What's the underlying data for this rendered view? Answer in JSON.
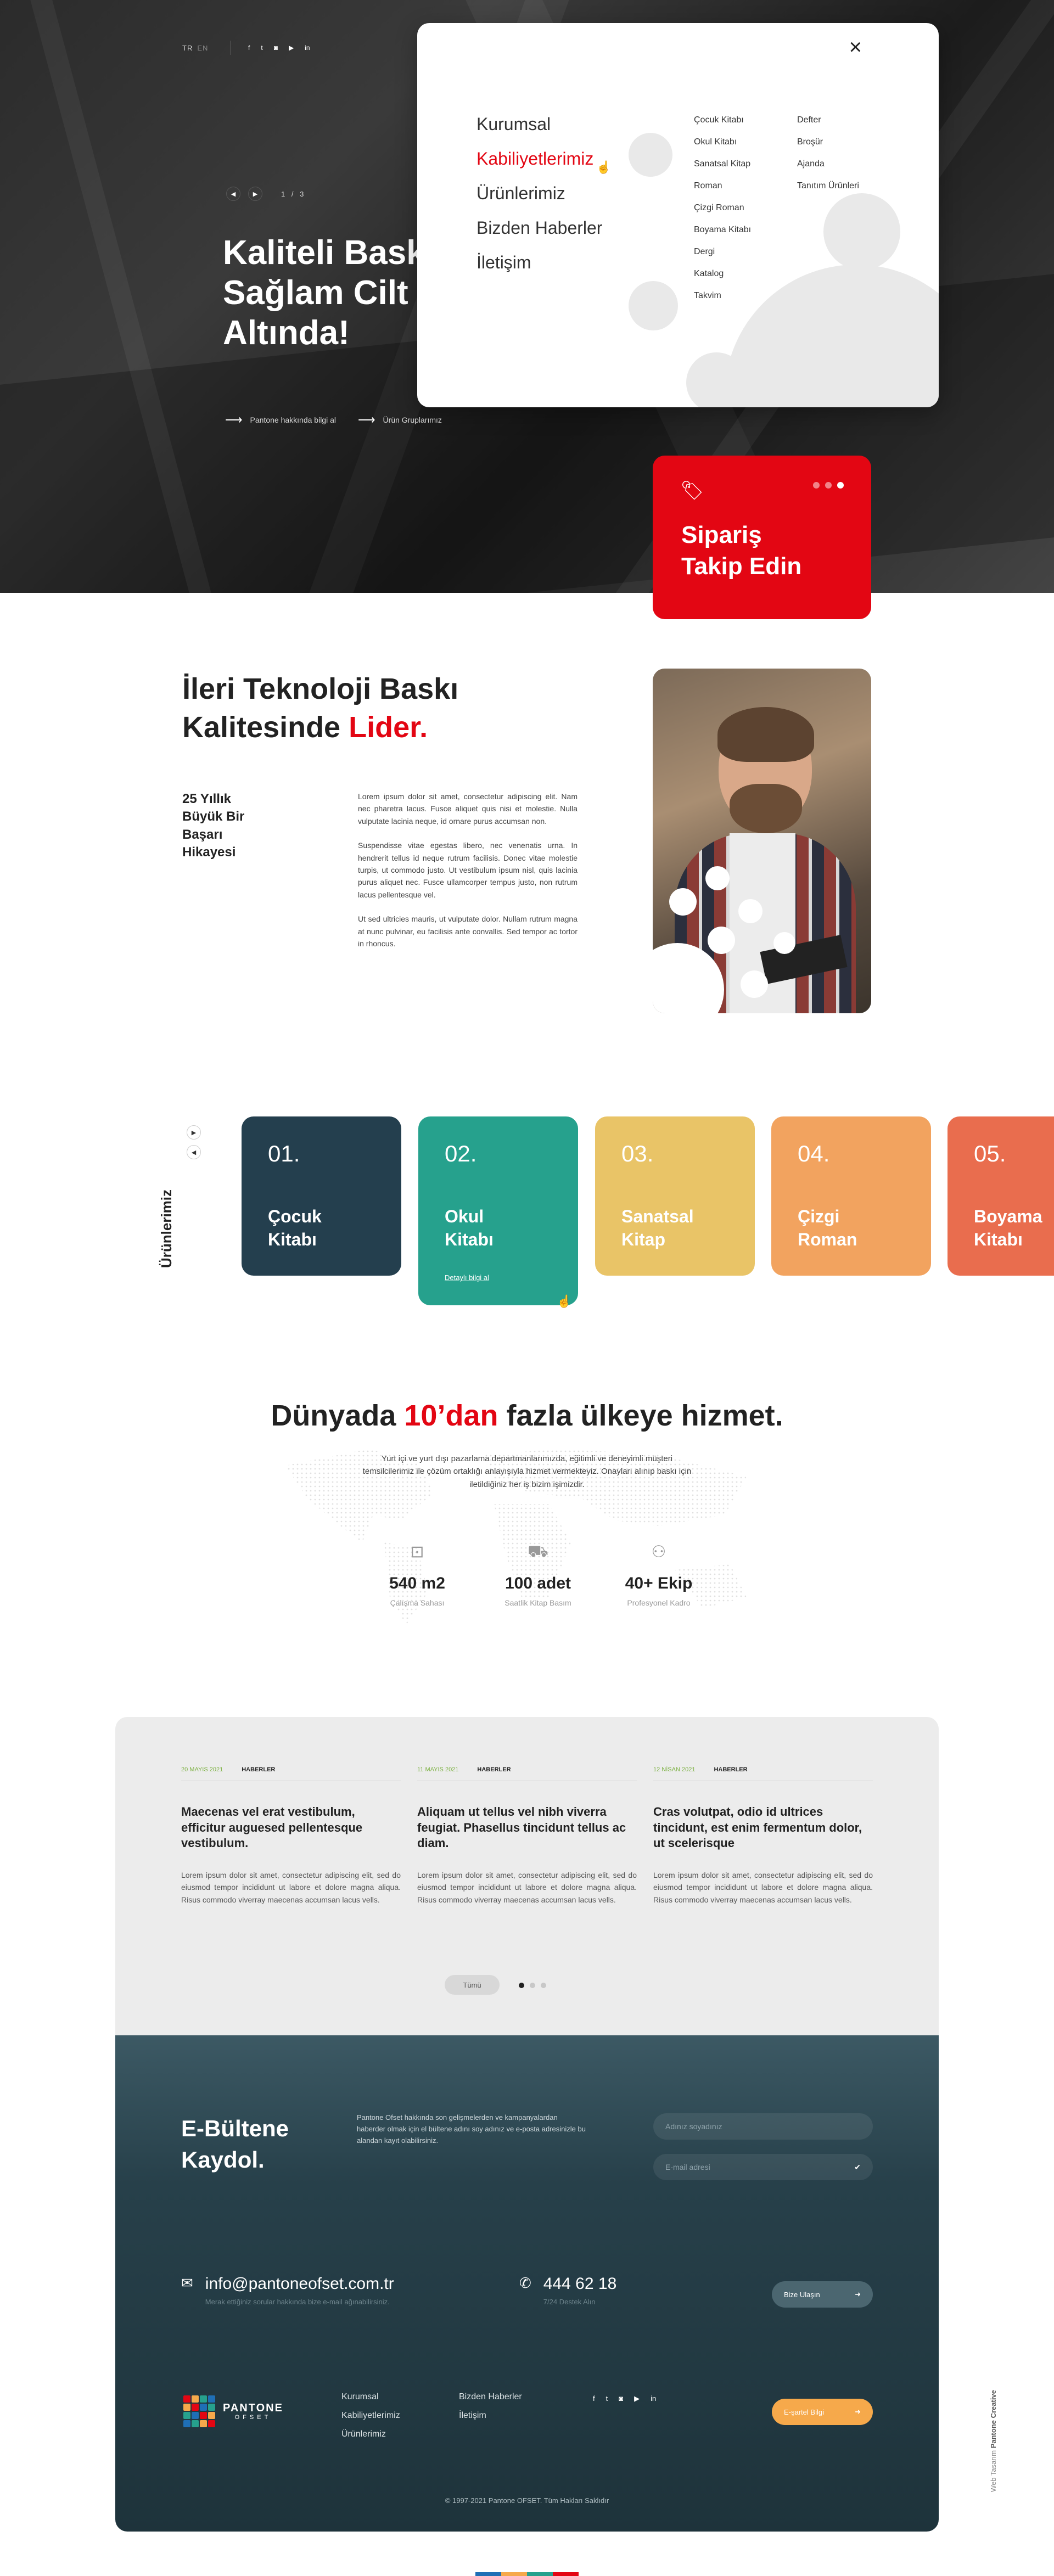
{
  "hero": {
    "lang": {
      "tr": "TR",
      "en": "EN"
    },
    "social": [
      "f",
      "t",
      "◙",
      "▶",
      "in"
    ],
    "slide_counter": "1 / 3",
    "title": "Kaliteli Baskı Sağlam Cilt Altında!",
    "links": [
      {
        "label": "Pantone hakkında bilgi al"
      },
      {
        "label": "Ürün Gruplarımız"
      }
    ]
  },
  "menu": {
    "main": [
      "Kurumsal",
      "Kabiliyetlerimiz",
      "Ürünlerimiz",
      "Bizden Haberler",
      "İletişim"
    ],
    "active_index": 1,
    "col1": [
      "Çocuk Kitabı",
      "Okul Kitabı",
      "Sanatsal Kitap",
      "Roman",
      "Çizgi Roman",
      "Boyama Kitabı",
      "Dergi",
      "Katalog",
      "Takvim"
    ],
    "col2": [
      "Defter",
      "Broşür",
      "Ajanda",
      "Tanıtım Ürünleri"
    ]
  },
  "order": {
    "title": "Sipariş Takip Edin"
  },
  "about": {
    "title_1": "İleri Teknoloji Baskı Kalitesinde ",
    "title_red": "Lider.",
    "side": "25 Yıllık Büyük Bir Başarı Hikayesi",
    "p1": "Lorem ipsum dolor sit amet, consectetur adipiscing elit. Nam nec pharetra lacus. Fusce aliquet quis nisi et molestie. Nulla vulputate lacinia neque, id ornare purus accumsan non.",
    "p2": "Suspendisse vitae egestas libero, nec venenatis urna. In hendrerit tellus id neque rutrum facilisis. Donec vitae molestie turpis, ut commodo justo. Ut vestibulum ipsum nisl, quis lacinia purus aliquet nec. Fusce ullamcorper tempus justo, non rutrum lacus pellentesque vel.",
    "p3": "Ut sed ultricies mauris, ut vulputate dolor. Nullam rutrum magna at nunc pulvinar, eu facilisis ante convallis. Sed tempor ac tortor in rhoncus."
  },
  "products": {
    "label": "Ürünlerimiz",
    "cards": [
      {
        "num": "01.",
        "name": "Çocuk Kitabı",
        "color": "#243f4e"
      },
      {
        "num": "02.",
        "name": "Okul Kitabı",
        "color": "#26a18d",
        "more": "Detaylı bilgi al"
      },
      {
        "num": "03.",
        "name": "Sanatsal Kitap",
        "color": "#e9c467"
      },
      {
        "num": "04.",
        "name": "Çizgi Roman",
        "color": "#f2a35f"
      },
      {
        "num": "05.",
        "name": "Boyama Kitabı",
        "color": "#e96d4e"
      }
    ]
  },
  "world": {
    "title_1": "Dünyada ",
    "title_red": "10’dan",
    "title_2": " fazla ülkeye hizmet.",
    "desc": "Yurt içi ve yurt dışı pazarlama departmanlarımızda, eğitimli ve deneyimli müşteri temsilcilerimiz ile çözüm ortaklığı anlayışıyla hizmet vermekteyiz. Onayları alınıp baskı için iletildiğiniz her iş bizim işimizdir.",
    "stats": [
      {
        "icon": "⊡",
        "value": "540 m2",
        "label": "Çalışma Sahası"
      },
      {
        "icon": "⛟",
        "value": "100 adet",
        "label": "Saatlik Kitap Basım"
      },
      {
        "icon": "⚇",
        "value": "40+ Ekip",
        "label": "Profesyonel Kadro"
      }
    ]
  },
  "news": {
    "items": [
      {
        "date": "20 MAYIS 2021",
        "cat": "HABERLER",
        "title": "Maecenas vel erat vestibulum, efficitur auguesed pellentesque vestibulum.",
        "body": "Lorem ipsum dolor sit amet, consectetur adipiscing elit, sed do eiusmod tempor incididunt ut labore et dolore magna aliqua. Risus commodo viverray maecenas accumsan lacus vells."
      },
      {
        "date": "11 MAYIS 2021",
        "cat": "HABERLER",
        "title": "Aliquam ut tellus vel nibh viverra feugiat. Phasellus tincidunt tellus ac diam.",
        "body": "Lorem ipsum dolor sit amet, consectetur adipiscing elit, sed do eiusmod tempor incididunt ut labore et dolore magna aliqua. Risus commodo viverray maecenas accumsan lacus vells."
      },
      {
        "date": "12 NİSAN 2021",
        "cat": "HABERLER",
        "title": "Cras volutpat, odio id ultrices tincidunt, est enim fermentum dolor, ut scelerisque",
        "body": "Lorem ipsum dolor sit amet, consectetur adipiscing elit, sed do eiusmod tempor incididunt ut labore et dolore magna aliqua. Risus commodo viverray maecenas accumsan lacus vells."
      }
    ],
    "all_label": "Tümü"
  },
  "footer": {
    "nl_title": "E-Bültene Kaydol.",
    "nl_desc": "Pantone Ofset hakkında son gelişmelerden ve kampanyalardan haberder olmak için el bültene adını soy adınız ve e-posta adresinizle bu alandan kayıt olabilirsiniz.",
    "name_placeholder": "Adınız soyadınız",
    "email_placeholder": "E-mail adresi",
    "email": "info@pantoneofset.com.tr",
    "email_note": "Merak ettiğiniz sorular hakkında bize e-mail ağınabilirsiniz.",
    "phone": "444 62 18",
    "phone_note": "7/24 Destek Alın",
    "contact_btn": "Bize Ulaşın",
    "logo_name": "PANTONE",
    "logo_sub": "OFSET",
    "nav1": [
      "Kurumsal",
      "Kabiliyetlerimiz",
      "Ürünlerimiz"
    ],
    "nav2": [
      "Bizden Haberler",
      "İletişim"
    ],
    "social": [
      "f",
      "t",
      "◙",
      "▶",
      "in"
    ],
    "apply_btn": "E-şartel Bilgi",
    "copyright": "© 1997-2021 Pantone OFSET. Tüm Hakları Saklıdır",
    "credit_1": "Web Tasarım ",
    "credit_2": "Pantone Creative"
  }
}
